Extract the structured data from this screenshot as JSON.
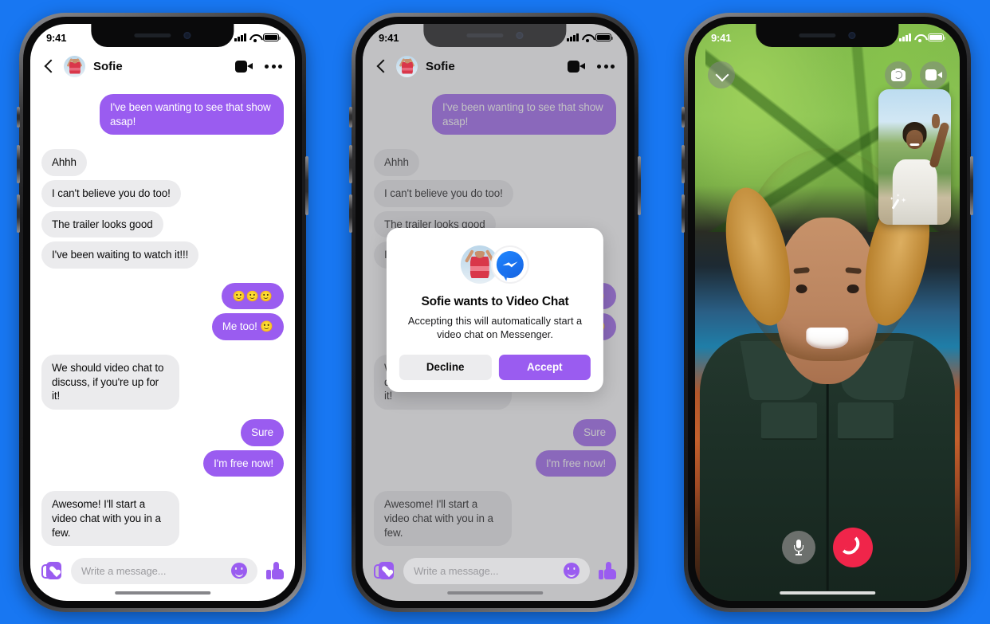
{
  "background_color": "#1877f2",
  "theme": {
    "accent_purple": "#9a5cf0",
    "bubble_in": "#ebebed",
    "end_call_red": "#f0254a",
    "messenger_blue": "#1a72ef"
  },
  "status_bar": {
    "time": "9:41",
    "icons": [
      "signal-bars",
      "wifi",
      "battery"
    ]
  },
  "chat": {
    "back_label": "Back",
    "contact_name": "Sofie",
    "actions": [
      "video-call",
      "more-options"
    ],
    "messages": [
      {
        "side": "out",
        "text": "I've been wanting to see that show asap!"
      },
      {
        "side": "in",
        "text": "Ahhh"
      },
      {
        "side": "in",
        "text": "I can't believe you do too!"
      },
      {
        "side": "in",
        "text": "The trailer looks good"
      },
      {
        "side": "in",
        "text": "I've been waiting to watch it!!!"
      },
      {
        "side": "out",
        "text": "🙂🙂🙂"
      },
      {
        "side": "out",
        "text": "Me too! 🙂"
      },
      {
        "side": "in",
        "text": "We should video chat to discuss, if you're up for it!"
      },
      {
        "side": "out",
        "text": "Sure"
      },
      {
        "side": "out",
        "text": "I'm free now!"
      },
      {
        "side": "in",
        "text": "Awesome! I'll start a video chat with you in a few."
      }
    ],
    "composer": {
      "placeholder": "Write a message...",
      "gift_icon": "gift-card-icon",
      "emoji_icon": "emoji-smiley-icon",
      "like_icon": "thumbs-up-icon"
    }
  },
  "modal": {
    "title": "Sofie wants to Video Chat",
    "subtitle": "Accepting this will automatically start a video chat on Messenger.",
    "decline_label": "Decline",
    "accept_label": "Accept",
    "app_icon": "messenger-logo-icon"
  },
  "video_call": {
    "minimize_icon": "chevron-down-icon",
    "flip_camera_icon": "flip-camera-icon",
    "toggle_video_icon": "video-camera-icon",
    "effects_icon": "magic-wand-icon",
    "mic_icon": "microphone-icon",
    "end_call_icon": "end-call-icon"
  }
}
